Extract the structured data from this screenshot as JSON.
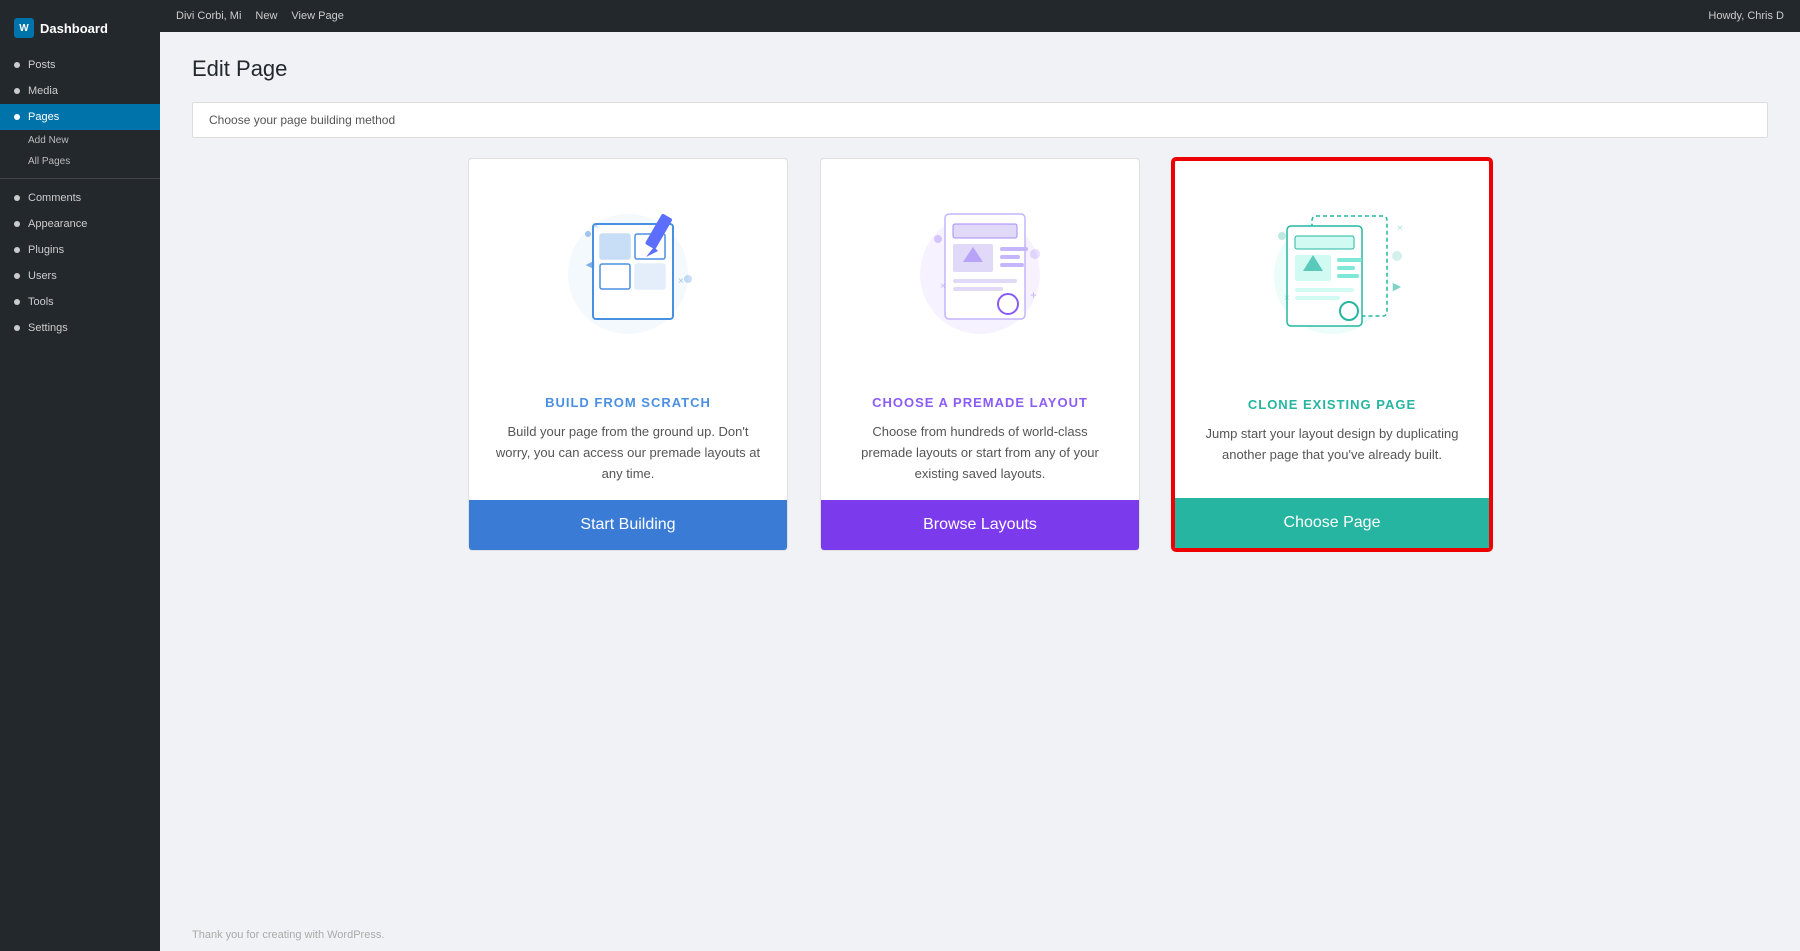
{
  "topbar": {
    "items": [
      "Divi Corbi, Mi",
      "New",
      "View Page"
    ],
    "right_label": "Howdy, Chris D"
  },
  "sidebar": {
    "logo": "Dashboard",
    "items": [
      {
        "label": "Posts",
        "active": false
      },
      {
        "label": "Media",
        "active": false
      },
      {
        "label": "Pages",
        "active": true
      },
      {
        "label": "Add New",
        "active": false
      },
      {
        "label": "All Pages",
        "active": false
      }
    ],
    "extra_items": [
      {
        "label": "Comments"
      },
      {
        "label": "Appearance"
      },
      {
        "label": "Plugins"
      },
      {
        "label": "Users"
      },
      {
        "label": "Tools"
      },
      {
        "label": "Settings"
      }
    ]
  },
  "page": {
    "title": "Edit Page",
    "subtitle": "Choose your page building method",
    "section_title": "Choose Your Page Building Method"
  },
  "cards": [
    {
      "id": "scratch",
      "title": "BUILD FROM SCRATCH",
      "title_class": "blue",
      "description": "Build your page from the ground up. Don't worry, you can access our premade layouts at any time.",
      "button_label": "Start Building",
      "button_class": "blue-btn",
      "selected": false
    },
    {
      "id": "layout",
      "title": "CHOOSE A PREMADE LAYOUT",
      "title_class": "purple",
      "description": "Choose from hundreds of world-class premade layouts or start from any of your existing saved layouts.",
      "button_label": "Browse Layouts",
      "button_class": "purple-btn",
      "selected": false
    },
    {
      "id": "clone",
      "title": "CLONE EXISTING PAGE",
      "title_class": "teal",
      "description": "Jump start your layout design by duplicating another page that you've already built.",
      "button_label": "Choose Page",
      "button_class": "teal-btn",
      "selected": true
    }
  ],
  "footer": {
    "label": "Thank you for creating with WordPress."
  }
}
